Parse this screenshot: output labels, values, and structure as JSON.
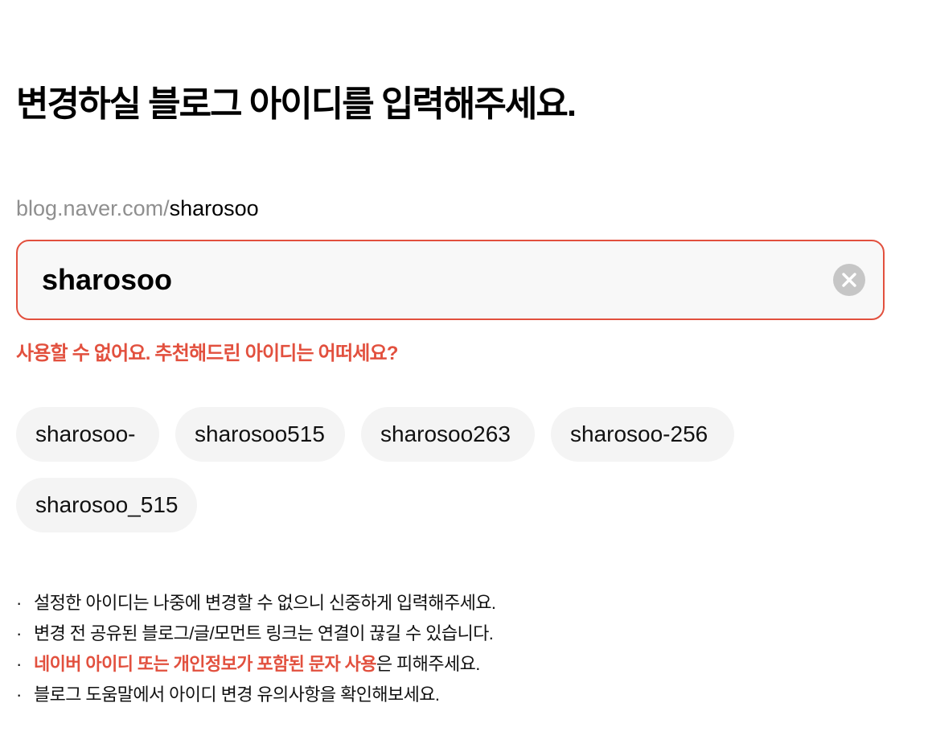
{
  "page": {
    "title": "변경하실 블로그 아이디를 입력해주세요."
  },
  "url_preview": {
    "prefix": "blog.naver.com/",
    "id": "sharosoo"
  },
  "id_input": {
    "value": "sharosoo",
    "clear_icon": "close-circle-icon"
  },
  "error": {
    "message": "사용할 수 없어요. 추천해드린 아이디는 어떠세요?"
  },
  "suggestions": [
    "sharosoo-",
    "sharosoo515",
    "sharosoo263",
    "sharosoo-256",
    "sharosoo_515"
  ],
  "notes": {
    "bullet": "·",
    "items": [
      {
        "text": "설정한 아이디는 나중에 변경할 수 없으니 신중하게 입력해주세요."
      },
      {
        "text": "변경 전 공유된 블로그/글/모먼트 링크는 연결이 끊길 수 있습니다."
      },
      {
        "highlight": "네이버 아이디 또는 개인정보가 포함된 문자 사용",
        "text": "은 피해주세요."
      },
      {
        "text": "블로그 도움말에서 아이디 변경 유의사항을 확인해보세요."
      }
    ]
  },
  "colors": {
    "accent": "#e2503e",
    "muted_text": "#8f8f8f",
    "chip_bg": "#f4f4f4",
    "input_bg": "#f8f8f8",
    "clear_btn": "#c6c6c6"
  }
}
